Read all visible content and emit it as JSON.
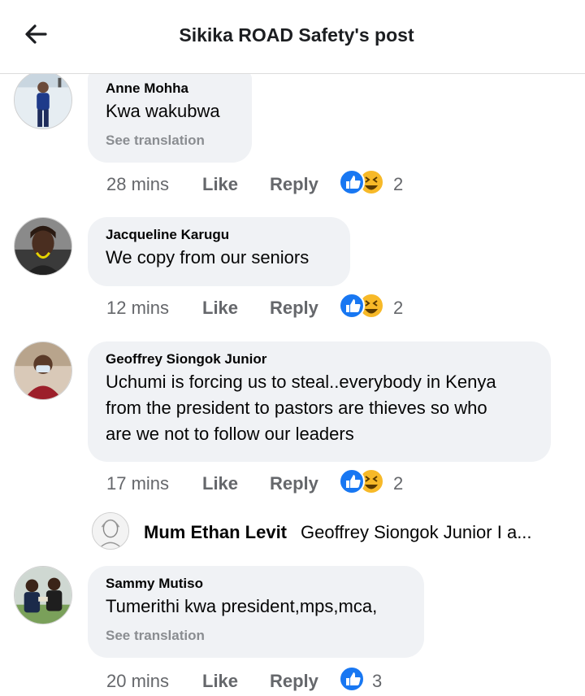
{
  "header": {
    "title": "Sikika ROAD Safety's post",
    "back_icon": "arrow-left-icon"
  },
  "colors": {
    "bubble": "#f0f2f5",
    "like_blue": "#1877f2",
    "haha_yellow": "#f7b928",
    "muted": "#65676b"
  },
  "comments": [
    {
      "name": "Anne Mohha",
      "text": [
        "Kwa wakubwa"
      ],
      "see_translation": "See translation",
      "time": "28 mins",
      "like": "Like",
      "reply": "Reply",
      "reactions": [
        "like-icon",
        "haha-icon"
      ],
      "reaction_count": "2"
    },
    {
      "name": "Jacqueline Karugu",
      "text": [
        "We copy from our seniors"
      ],
      "time": "12 mins",
      "like": "Like",
      "reply": "Reply",
      "reactions": [
        "like-icon",
        "haha-icon"
      ],
      "reaction_count": "2"
    },
    {
      "name": "Geoffrey Siongok Junior",
      "text": [
        "Uchumi is forcing us to steal..everybody in Kenya",
        "from the president to pastors are thieves so who",
        "are we not to follow our leaders"
      ],
      "time": "17 mins",
      "like": "Like",
      "reply": "Reply",
      "reactions": [
        "like-icon",
        "haha-icon"
      ],
      "reaction_count": "2",
      "reply_preview": {
        "name": "Mum Ethan Levit",
        "text": "Geoffrey Siongok Junior I a..."
      }
    },
    {
      "name": "Sammy Mutiso",
      "text": [
        "Tumerithi kwa president,mps,mca,"
      ],
      "see_translation": "See translation",
      "time": "20 mins",
      "like": "Like",
      "reply": "Reply",
      "reactions": [
        "like-icon"
      ],
      "reaction_count": "3"
    }
  ]
}
